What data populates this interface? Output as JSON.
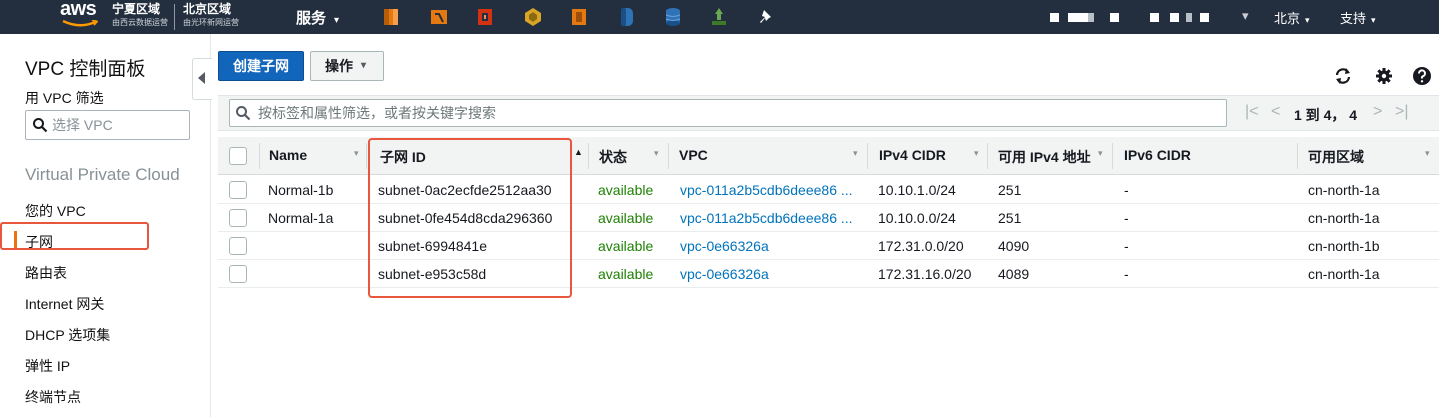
{
  "topbar": {
    "logo": "aws",
    "regions": [
      {
        "title": "宁夏区域",
        "subtitle": "由西云数据运营"
      },
      {
        "title": "北京区域",
        "subtitle": "由光环新网运营"
      }
    ],
    "services_label": "服务",
    "service_icons": [
      "ec2-icon",
      "lambda-icon",
      "cloudformation-icon",
      "sns-icon",
      "ecs-icon",
      "dynamodb-icon",
      "rds-icon",
      "elastic-beanstalk-icon",
      "pin-icon"
    ],
    "region_menu": "北京",
    "support_menu": "支持",
    "caret": "▾"
  },
  "sidebar": {
    "title": "VPC 控制面板",
    "filter_label": "用 VPC 筛选",
    "filter_placeholder": "选择 VPC",
    "section": "Virtual Private Cloud",
    "items": [
      "您的 VPC",
      "子网",
      "路由表",
      "Internet 网关",
      "DHCP 选项集",
      "弹性 IP",
      "终端节点"
    ],
    "active_item": "子网"
  },
  "toolbar": {
    "create_label": "创建子网",
    "actions_label": "操作"
  },
  "search": {
    "placeholder": "按标签和属性筛选，或者按关键字搜索"
  },
  "pagination": {
    "text": "1 到 4， 4",
    "first": "|<",
    "prev": "<",
    "next": ">",
    "last": ">|"
  },
  "table": {
    "columns": [
      "Name",
      "子网 ID",
      "状态",
      "VPC",
      "IPv4 CIDR",
      "可用 IPv4 地址",
      "IPv6 CIDR",
      "可用区域"
    ],
    "rows": [
      {
        "name": "Normal-1b",
        "subnet_id": "subnet-0ac2ecfde2512aa30",
        "state": "available",
        "vpc": "vpc-011a2b5cdb6deee86 ...",
        "ipv4_cidr": "10.10.1.0/24",
        "available_ipv4": "251",
        "ipv6_cidr": "-",
        "az": "cn-north-1a"
      },
      {
        "name": "Normal-1a",
        "subnet_id": "subnet-0fe454d8cda296360",
        "state": "available",
        "vpc": "vpc-011a2b5cdb6deee86 ...",
        "ipv4_cidr": "10.10.0.0/24",
        "available_ipv4": "251",
        "ipv6_cidr": "-",
        "az": "cn-north-1a"
      },
      {
        "name": "",
        "subnet_id": "subnet-6994841e",
        "state": "available",
        "vpc": "vpc-0e66326a",
        "ipv4_cidr": "172.31.0.0/20",
        "available_ipv4": "4090",
        "ipv6_cidr": "-",
        "az": "cn-north-1b"
      },
      {
        "name": "",
        "subnet_id": "subnet-e953c58d",
        "state": "available",
        "vpc": "vpc-0e66326a",
        "ipv4_cidr": "172.31.16.0/20",
        "available_ipv4": "4089",
        "ipv6_cidr": "-",
        "az": "cn-north-1a"
      }
    ]
  },
  "colors": {
    "nav_bg": "#232f3e",
    "primary": "#1166bb",
    "accent": "#ec7211",
    "highlight": "#e8573d",
    "available": "#1d8102",
    "link": "#0073bb"
  }
}
